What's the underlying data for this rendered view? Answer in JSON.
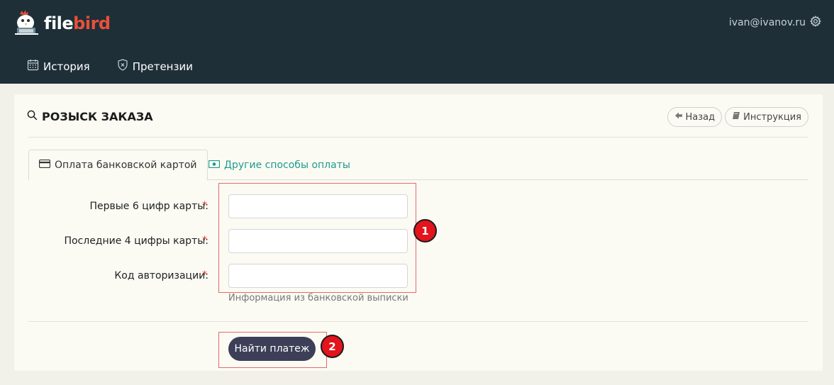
{
  "header": {
    "logo_file": "file",
    "logo_bird": "bird",
    "user_email": "ivan@ivanov.ru",
    "nav": [
      {
        "label": "История",
        "icon": "calendar-icon"
      },
      {
        "label": "Претензии",
        "icon": "shield-icon"
      }
    ]
  },
  "page": {
    "title": "РОЗЫСК ЗАКАЗА",
    "back_label": "Назад",
    "guide_label": "Инструкция"
  },
  "tabs": [
    {
      "label": "Оплата банковской картой",
      "icon": "credit-card-icon",
      "active": true
    },
    {
      "label": "Другие способы оплаты",
      "icon": "cash-icon",
      "active": false
    }
  ],
  "form": {
    "fields": [
      {
        "label": "Первые 6 цифр карты:",
        "required": "*",
        "value": "",
        "placeholder": ""
      },
      {
        "label": "Последние 4 цифры карты:",
        "required": "*",
        "value": "",
        "placeholder": ""
      },
      {
        "label": "Код авторизации:",
        "required": "*",
        "value": "",
        "placeholder": ""
      }
    ],
    "hint": "Информация из банковской выписки",
    "submit_label": "Найти платеж"
  },
  "annotations": {
    "badge1": "1",
    "badge2": "2"
  },
  "colors": {
    "topbar": "#1e2f38",
    "accent": "#e8503a",
    "tab_link": "#1d9b8c",
    "button": "#3c3f57",
    "required": "#d9342b",
    "annotation": "#e3141b"
  }
}
